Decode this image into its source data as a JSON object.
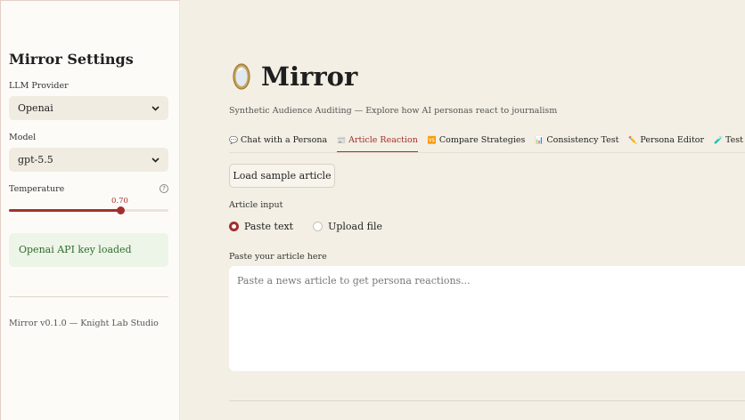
{
  "sidebar": {
    "title": "Mirror Settings",
    "provider_label": "LLM Provider",
    "provider_value": "Openai",
    "model_label": "Model",
    "model_value": "gpt-5.5",
    "temperature_label": "Temperature",
    "temperature_value": "0.70",
    "temperature_fraction": 0.7,
    "api_status": "Openai API key loaded",
    "footer": "Mirror v0.1.0 — Knight Lab Studio"
  },
  "header": {
    "title": "Mirror",
    "subtitle": "Synthetic Audience Auditing — Explore how AI personas react to journalism"
  },
  "tabs": [
    {
      "icon": "💬",
      "label": "Chat with a Persona",
      "active": false
    },
    {
      "icon": "📰",
      "label": "Article Reaction",
      "active": true
    },
    {
      "icon": "🆚",
      "label": "Compare Strategies",
      "active": false
    },
    {
      "icon": "📊",
      "label": "Consistency Test",
      "active": false
    },
    {
      "icon": "✏️",
      "label": "Persona Editor",
      "active": false
    },
    {
      "icon": "🧪",
      "label": "Test",
      "active": false
    }
  ],
  "article": {
    "load_sample_label": "Load sample article",
    "input_label": "Article input",
    "options": [
      "Paste text",
      "Upload file"
    ],
    "selected_option": "Paste text",
    "paste_label": "Paste your article here",
    "placeholder": "Paste a news article to get persona reactions..."
  },
  "colors": {
    "accent": "#a1302c",
    "background": "#f3efe4",
    "sidebar": "#fdfbf7",
    "success_bg": "#edf5e8",
    "success_text": "#2f6b2c"
  }
}
